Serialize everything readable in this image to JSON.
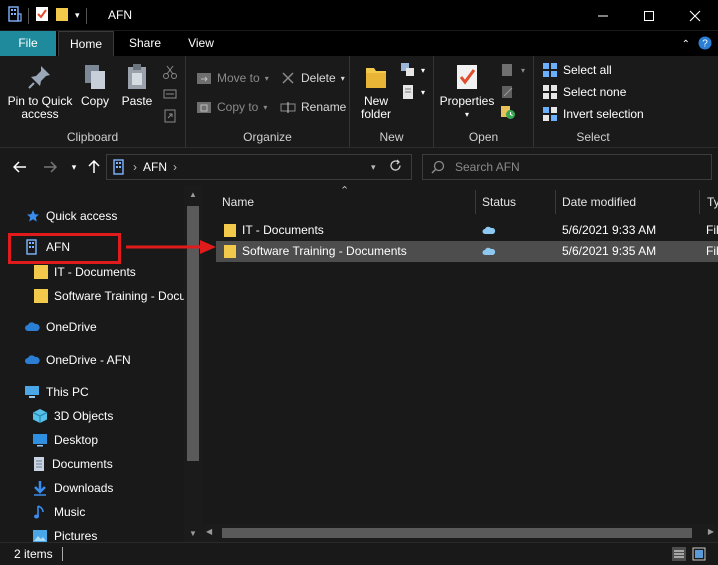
{
  "window": {
    "title": "AFN",
    "minimize": "—",
    "maximize": "☐",
    "close": "✕"
  },
  "ribbon_tabs": {
    "file": "File",
    "home": "Home",
    "share": "Share",
    "view": "View"
  },
  "ribbon": {
    "clipboard": {
      "label": "Clipboard",
      "pin_line1": "Pin to Quick",
      "pin_line2": "access",
      "copy": "Copy",
      "paste": "Paste"
    },
    "organize": {
      "label": "Organize",
      "move_to": "Move to",
      "copy_to": "Copy to",
      "delete": "Delete",
      "rename": "Rename"
    },
    "new": {
      "label": "New",
      "new_folder_line1": "New",
      "new_folder_line2": "folder"
    },
    "open": {
      "label": "Open",
      "properties": "Properties"
    },
    "select": {
      "label": "Select",
      "select_all": "Select all",
      "select_none": "Select none",
      "invert_selection": "Invert selection"
    }
  },
  "address": {
    "path_item": "AFN",
    "search_placeholder": "Search AFN"
  },
  "nav": {
    "quick_access": "Quick access",
    "afn": "AFN",
    "it_documents": "IT - Documents",
    "software_training": "Software Training - Documents",
    "onedrive": "OneDrive",
    "onedrive_afn": "OneDrive - AFN",
    "this_pc": "This PC",
    "objects_3d": "3D Objects",
    "desktop": "Desktop",
    "documents": "Documents",
    "downloads": "Downloads",
    "music": "Music",
    "pictures": "Pictures"
  },
  "columns": {
    "name": "Name",
    "status": "Status",
    "date_modified": "Date modified",
    "type": "Ty"
  },
  "files": [
    {
      "name": "IT - Documents",
      "date": "5/6/2021 9:33 AM",
      "type": "Fil"
    },
    {
      "name": "Software Training - Documents",
      "date": "5/6/2021 9:35 AM",
      "type": "Fil"
    }
  ],
  "status": {
    "item_count": "2 items"
  },
  "colors": {
    "accent_file_tab": "#1e8a9c",
    "annotation_red": "#e11b1b",
    "folder_yellow": "#f3c94b",
    "cloud_blue": "#8cc8f0"
  }
}
